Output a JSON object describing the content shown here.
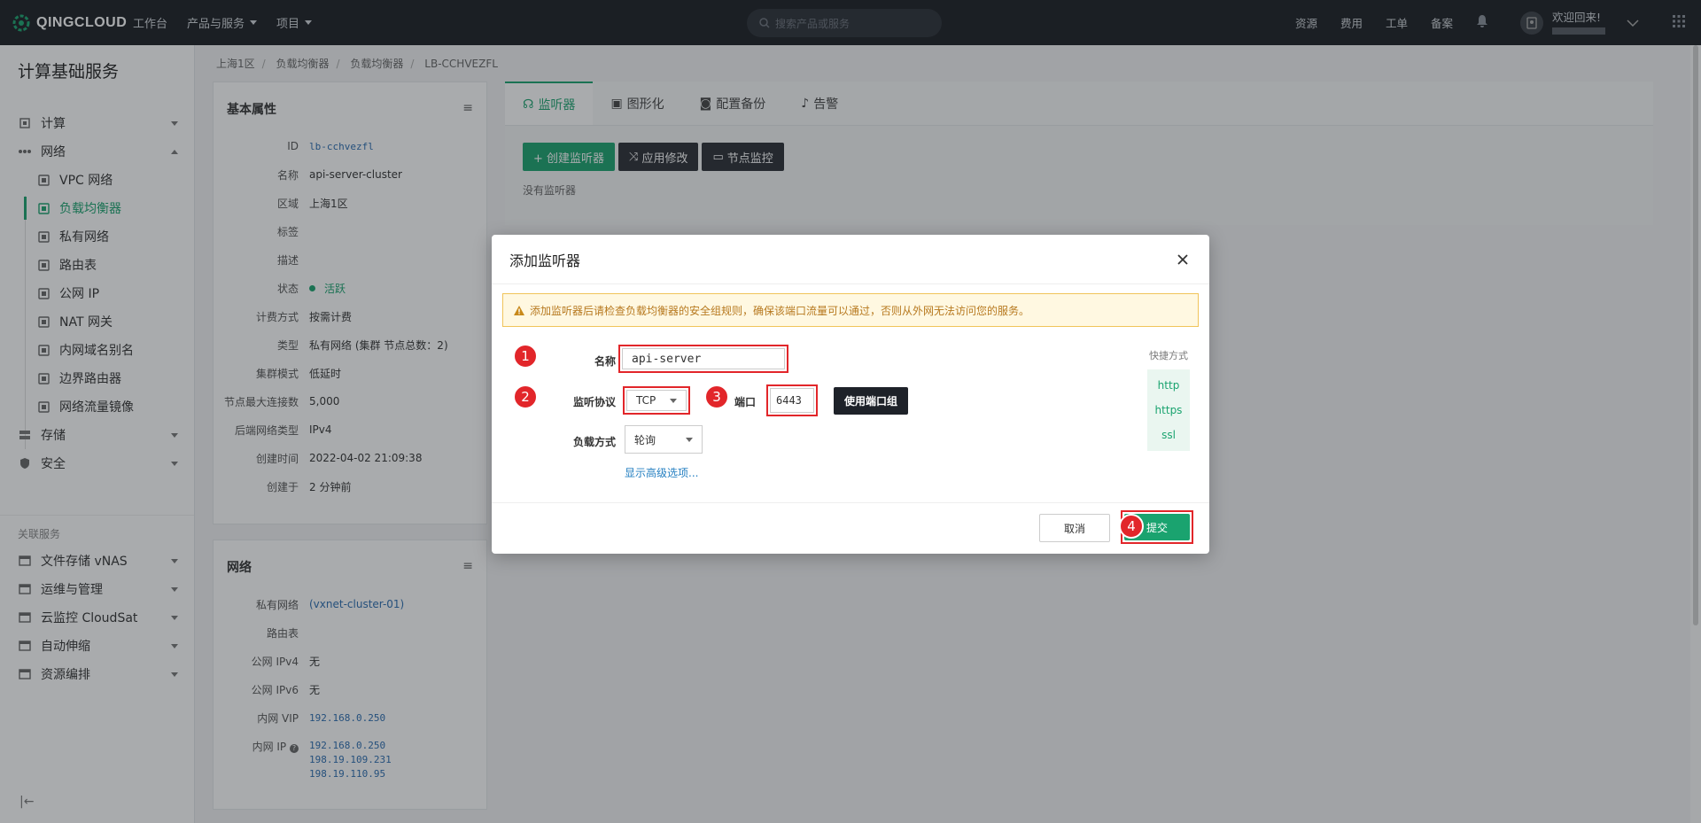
{
  "topbar": {
    "brand": "QINGCLOUD",
    "nav": [
      "工作台",
      "产品与服务",
      "项目"
    ],
    "search_placeholder": "搜索产品或服务",
    "links": [
      "资源",
      "费用",
      "工单",
      "备案"
    ],
    "welcome": "欢迎回来!"
  },
  "sidebar": {
    "title": "计算基础服务",
    "groups": [
      {
        "label": "计算",
        "icon": "cpu-icon"
      },
      {
        "label": "网络",
        "icon": "network-icon"
      }
    ],
    "network_items": [
      {
        "label": "VPC 网络",
        "icon": "vpc-icon"
      },
      {
        "label": "负载均衡器",
        "icon": "load-balancer-icon"
      },
      {
        "label": "私有网络",
        "icon": "private-network-icon"
      },
      {
        "label": "路由表",
        "icon": "route-table-icon"
      },
      {
        "label": "公网 IP",
        "icon": "public-ip-icon"
      },
      {
        "label": "NAT 网关",
        "icon": "nat-gateway-icon"
      },
      {
        "label": "内网域名别名",
        "icon": "dns-alias-icon"
      },
      {
        "label": "边界路由器",
        "icon": "border-router-icon"
      },
      {
        "label": "网络流量镜像",
        "icon": "traffic-mirror-icon"
      }
    ],
    "other_groups": [
      {
        "label": "存储",
        "icon": "storage-icon"
      },
      {
        "label": "安全",
        "icon": "security-icon"
      }
    ],
    "related_title": "关联服务",
    "related": [
      {
        "label": "文件存储 vNAS",
        "icon": "nas-icon"
      },
      {
        "label": "运维与管理",
        "icon": "ops-icon"
      },
      {
        "label": "云监控 CloudSat",
        "icon": "monitor-icon"
      },
      {
        "label": "自动伸缩",
        "icon": "autoscale-icon"
      },
      {
        "label": "资源编排",
        "icon": "orchestration-icon"
      }
    ],
    "collapse_glyph": "|←"
  },
  "breadcrumb": [
    "上海1区",
    "负载均衡器",
    "负载均衡器",
    "LB-CCHVEZFL"
  ],
  "basic": {
    "title": "基本属性",
    "menu": "≡",
    "rows": [
      {
        "k": "ID",
        "v": "lb-cchvezfl",
        "mono": true
      },
      {
        "k": "名称",
        "v": "api-server-cluster"
      },
      {
        "k": "区域",
        "v": "上海1区"
      },
      {
        "k": "标签",
        "v": ""
      },
      {
        "k": "描述",
        "v": ""
      },
      {
        "k": "状态",
        "v": "活跃",
        "status": true
      },
      {
        "k": "计费方式",
        "v": "按需计费"
      },
      {
        "k": "类型",
        "v": "私有网络 (集群 节点总数：2)"
      },
      {
        "k": "集群模式",
        "v": "低延时"
      },
      {
        "k": "节点最大连接数",
        "v": "5,000"
      },
      {
        "k": "后端网络类型",
        "v": "IPv4"
      },
      {
        "k": "创建时间",
        "v": "2022-04-02 21:09:38"
      },
      {
        "k": "创建于",
        "v": "2 分钟前"
      }
    ]
  },
  "network": {
    "title": "网络",
    "menu": "≡",
    "rows": [
      {
        "k": "私有网络",
        "v": "(vxnet-cluster-01)"
      },
      {
        "k": "路由表",
        "v": ""
      },
      {
        "k": "公网 IPv4",
        "v": "无"
      },
      {
        "k": "公网 IPv6",
        "v": "无"
      },
      {
        "k": "内网 VIP",
        "v": "192.168.0.250",
        "mono": true
      }
    ],
    "ip_label": "内网 IP",
    "ips": [
      "192.168.0.250",
      "198.19.109.231",
      "198.19.110.95"
    ]
  },
  "tabs": [
    {
      "label": "监听器",
      "icon": "headset-icon"
    },
    {
      "label": "图形化",
      "icon": "image-icon"
    },
    {
      "label": "配置备份",
      "icon": "camera-icon"
    },
    {
      "label": "告警",
      "icon": "bell-icon"
    }
  ],
  "toolbar": {
    "create": "+ 创建监听器",
    "apply": "应用修改",
    "monitor": "节点监控",
    "empty": "没有监听器"
  },
  "modal": {
    "title": "添加监听器",
    "warning": "添加监听器后请检查负载均衡器的安全组规则，确保该端口流量可以通过，否则从外网无法访问您的服务。",
    "name_label": "名称",
    "name_value": "api-server",
    "protocol_label": "监听协议",
    "protocol_value": "TCP",
    "port_label": "端口",
    "port_value": "6443",
    "port_group_btn": "使用端口组",
    "balance_label": "负载方式",
    "balance_value": "轮询",
    "advanced_link": "显示高级选项...",
    "quick_title": "快捷方式",
    "quick": [
      "http",
      "https",
      "ssl"
    ],
    "cancel": "取消",
    "submit": "提交",
    "badges": [
      "1",
      "2",
      "3",
      "4"
    ]
  },
  "colors": {
    "accent": "#1aa36f",
    "danger": "#e2262a",
    "topbar": "#1a1d23"
  }
}
